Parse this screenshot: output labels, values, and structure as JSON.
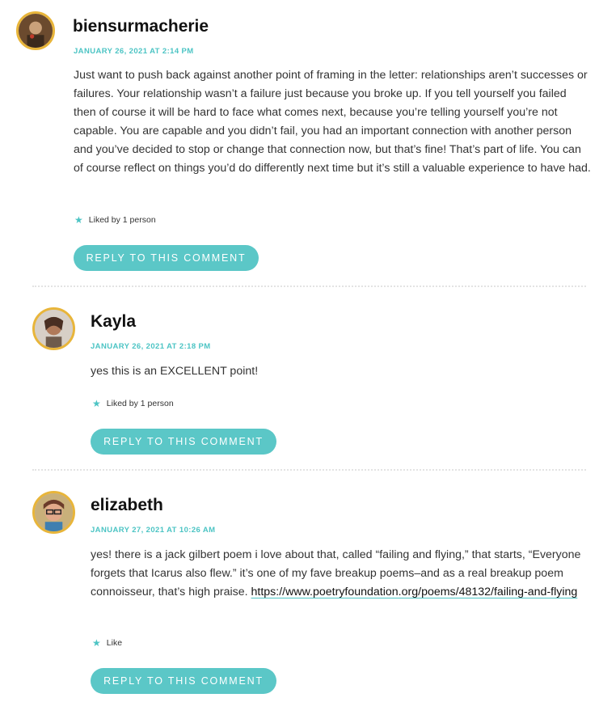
{
  "comments": [
    {
      "author": "biensurmacherie",
      "date": "JANUARY 26, 2021 AT 2:14 PM",
      "body": "Just want to push back against another point of framing in the letter: relationships aren’t successes or failures. Your relationship wasn’t a failure just because you broke up. If you tell yourself you failed then of course it will be hard to face what comes next, because you’re telling yourself you’re not capable. You are capable and you didn’t fail, you had an important connection with another person and you’ve decided to stop or change that connection now, but that’s fine! That’s part of life. You can of course reflect on things you’d do differently next time but it’s still a valuable experience to have had.",
      "likes": "Liked by 1 person",
      "reply_label": "REPLY TO THIS COMMENT"
    },
    {
      "author": "Kayla",
      "date": "JANUARY 26, 2021 AT 2:18 PM",
      "body": "yes this is an EXCELLENT point!",
      "likes": "Liked by 1 person",
      "reply_label": "REPLY TO THIS COMMENT"
    },
    {
      "author": "elizabeth",
      "date": "JANUARY 27, 2021 AT 10:26 AM",
      "body": "yes! there is a jack gilbert poem i love about that, called “failing and flying,” that starts, “Everyone forgets that Icarus also flew.” it’s one of my fave breakup poems–and as a real breakup poem connoisseur, that’s high praise. ",
      "link": "https://www.poetryfoundation.org/poems/48132/failing-and-flying",
      "likes": "Like",
      "reply_label": "REPLY TO THIS COMMENT"
    }
  ],
  "colors": {
    "accent": "#4cc4c4",
    "button": "#5bc7c7",
    "avatar_border": "#e8b53a"
  },
  "icons": {
    "like": "star-icon"
  }
}
